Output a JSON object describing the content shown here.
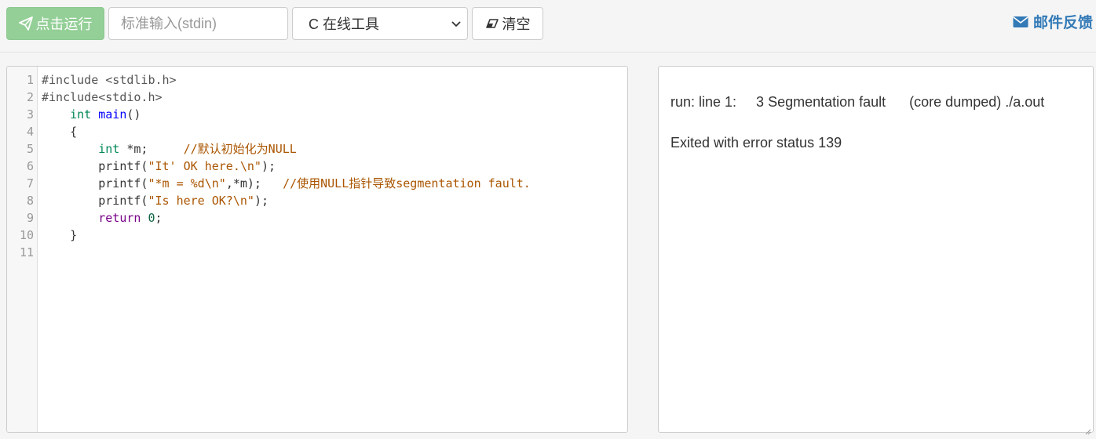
{
  "toolbar": {
    "run_label": "点击运行",
    "stdin_placeholder": "标准输入(stdin)",
    "lang_selected": "C 在线工具",
    "clear_label": "清空",
    "feedback_label": "邮件反馈",
    "run_icon": "paper-plane-icon",
    "clear_icon": "eraser-icon",
    "feedback_icon": "envelope-icon",
    "run_color": "#93cf96",
    "feedback_color": "#337ab7"
  },
  "editor": {
    "line_numbers": [
      "1",
      "2",
      "3",
      "4",
      "5",
      "6",
      "7",
      "8",
      "9",
      "10",
      "11"
    ],
    "lines": [
      [
        {
          "t": "meta",
          "v": "#include <stdlib.h>"
        }
      ],
      [
        {
          "t": "meta",
          "v": "#include<stdio.h>"
        }
      ],
      [
        {
          "t": "ws",
          "v": "    "
        },
        {
          "t": "type",
          "v": "int"
        },
        {
          "t": "ws",
          "v": " "
        },
        {
          "t": "def",
          "v": "main"
        },
        {
          "t": "var",
          "v": "()"
        }
      ],
      [
        {
          "t": "ws",
          "v": "    "
        },
        {
          "t": "var",
          "v": "{"
        }
      ],
      [
        {
          "t": "ws",
          "v": "        "
        },
        {
          "t": "type",
          "v": "int"
        },
        {
          "t": "ws",
          "v": " "
        },
        {
          "t": "var",
          "v": "*m;"
        },
        {
          "t": "ws",
          "v": "     "
        },
        {
          "t": "com",
          "v": "//默认初始化为NULL"
        }
      ],
      [
        {
          "t": "ws",
          "v": "        "
        },
        {
          "t": "var",
          "v": "printf("
        },
        {
          "t": "str",
          "v": "\"It' OK here.\\n\""
        },
        {
          "t": "var",
          "v": ");"
        }
      ],
      [
        {
          "t": "ws",
          "v": "        "
        },
        {
          "t": "var",
          "v": "printf("
        },
        {
          "t": "str",
          "v": "\"*m = %d\\n\""
        },
        {
          "t": "var",
          "v": ",*m);"
        },
        {
          "t": "ws",
          "v": "   "
        },
        {
          "t": "com",
          "v": "//使用NULL指针导致segmentation fault."
        }
      ],
      [
        {
          "t": "ws",
          "v": "        "
        },
        {
          "t": "var",
          "v": "printf("
        },
        {
          "t": "str",
          "v": "\"Is here OK?\\n\""
        },
        {
          "t": "var",
          "v": ");"
        }
      ],
      [
        {
          "t": "ws",
          "v": "        "
        },
        {
          "t": "kw",
          "v": "return"
        },
        {
          "t": "ws",
          "v": " "
        },
        {
          "t": "num",
          "v": "0"
        },
        {
          "t": "var",
          "v": ";"
        }
      ],
      [
        {
          "t": "ws",
          "v": "    "
        },
        {
          "t": "var",
          "v": "}"
        }
      ],
      []
    ]
  },
  "output": {
    "line1": "run: line 1:     3 Segmentation fault      (core dumped) ./a.out",
    "line2": "Exited with error status 139"
  }
}
